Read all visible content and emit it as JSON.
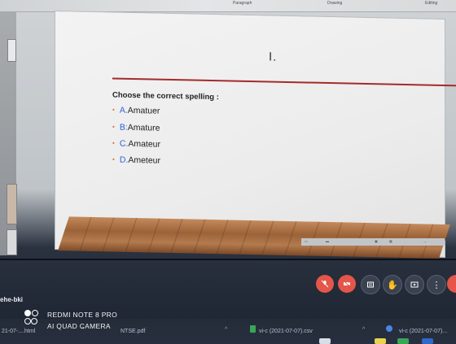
{
  "ribbon": {
    "paragraph_label": "Paragraph",
    "drawing_label": "Drawing",
    "editing_label": "Editing"
  },
  "slide": {
    "title": "I.",
    "question": "Choose the correct spelling :",
    "options": [
      {
        "letter": "A.",
        "text": "Amatuer"
      },
      {
        "letter": "B:",
        "text": "Amature"
      },
      {
        "letter": "C.",
        "text": "Amateur"
      },
      {
        "letter": "D.",
        "text": "Ameteur"
      }
    ]
  },
  "meeting": {
    "participant_name": "ehe-bki",
    "controls": [
      "mic-muted-icon",
      "video-off-icon",
      "chat-icon",
      "raise-hand-icon",
      "share-screen-icon",
      "more-icon",
      "end-call-icon"
    ]
  },
  "watermark": {
    "line1": "REDMI NOTE 8 PRO",
    "line2": "AI QUAD CAMERA"
  },
  "downloads": [
    {
      "name": "21-07-....html"
    },
    {
      "name": "NTSE.pdf"
    },
    {
      "name": "vi-c (2021-07-07).csv"
    },
    {
      "name": "vi-c (2021-07-07)..."
    }
  ],
  "colors": {
    "slide_rule": "#a52a2a",
    "option_letter": "#2b62d1",
    "control_red": "#e4564a"
  }
}
